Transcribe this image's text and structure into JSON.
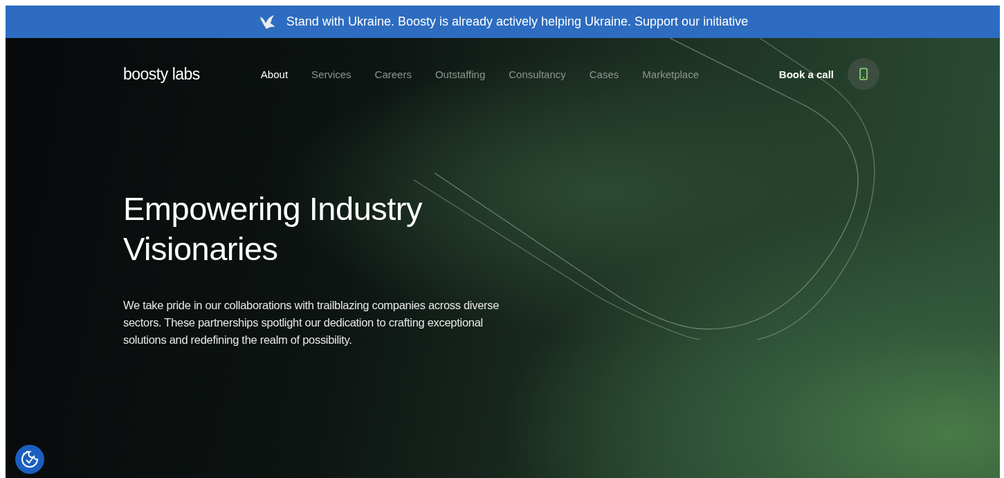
{
  "banner": {
    "text": "Stand with Ukraine. Boosty is already actively helping Ukraine. Support our initiative"
  },
  "header": {
    "logo": "boosty labs",
    "nav": [
      {
        "label": "About",
        "selected": true
      },
      {
        "label": "Services",
        "selected": false
      },
      {
        "label": "Careers",
        "selected": false
      },
      {
        "label": "Outstaffing",
        "selected": false
      },
      {
        "label": "Consultancy",
        "selected": false
      },
      {
        "label": "Cases",
        "selected": false
      },
      {
        "label": "Marketplace",
        "selected": false
      }
    ],
    "cta": "Book a call"
  },
  "hero": {
    "title": "Empowering Industry Visionaries",
    "description": "We take pride in our collaborations with trailblazing companies across diverse sectors. These partnerships spotlight our dedication to crafting exceptional solutions and redefining the realm of possibility."
  }
}
